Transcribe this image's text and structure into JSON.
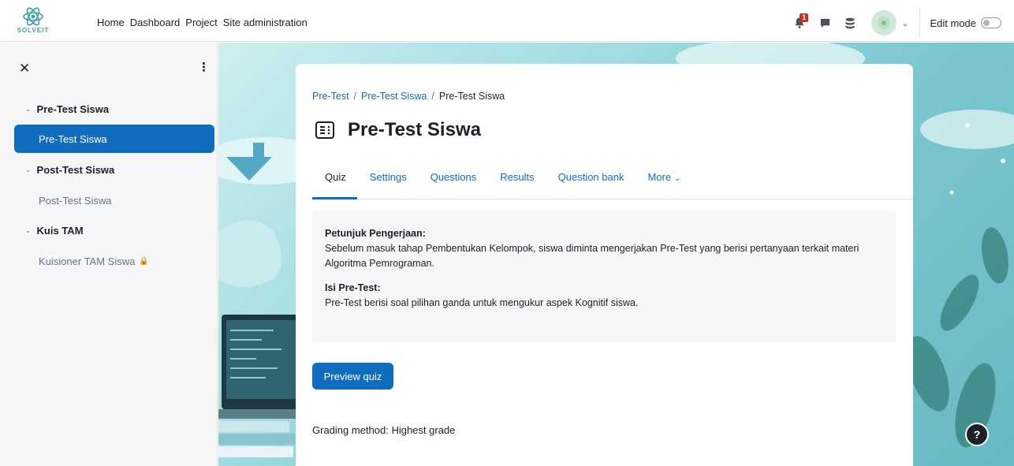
{
  "brand": {
    "logo_text": "SOLVEIT"
  },
  "nav": {
    "links": [
      "Home",
      "Dashboard",
      "Project",
      "Site administration"
    ],
    "notifications_count": "1",
    "edit_mode_label": "Edit mode"
  },
  "drawer": {
    "sections": [
      {
        "title": "Pre-Test Siswa",
        "items": [
          {
            "label": "Pre-Test Siswa",
            "active": true
          }
        ]
      },
      {
        "title": "Post-Test Siswa",
        "items": [
          {
            "label": "Post-Test Siswa",
            "active": false
          }
        ]
      },
      {
        "title": "Kuis TAM",
        "items": [
          {
            "label": "Kuisioner TAM Siswa",
            "active": false,
            "locked": true
          }
        ]
      }
    ]
  },
  "breadcrumb": [
    "Pre-Test",
    "Pre-Test Siswa",
    "Pre-Test Siswa"
  ],
  "page_title": "Pre-Test Siswa",
  "tabs": [
    "Quiz",
    "Settings",
    "Questions",
    "Results",
    "Question bank",
    "More"
  ],
  "intro": {
    "heading1": "Petunjuk Pengerjaan:",
    "text1": "Sebelum masuk tahap Pembentukan Kelompok, siswa diminta mengerjakan Pre-Test yang berisi pertanyaan terkait materi Algoritma Pemrograman.",
    "heading2": "Isi Pre-Test:",
    "text2": "Pre-Test berisi soal pilihan ganda untuk mengukur aspek Kognitif siswa."
  },
  "preview_button": "Preview quiz",
  "grading_method": "Grading method: Highest grade",
  "help_label": "?",
  "colors": {
    "primary": "#0f6cbf",
    "text": "#1d2125",
    "drawer_bg": "#f5f6f7",
    "badge": "#ca3120"
  },
  "icons": [
    "logo-icon",
    "bell-icon",
    "message-icon",
    "database-icon",
    "avatar",
    "chevron-down-icon",
    "close-icon",
    "kebab-icon",
    "quiz-icon",
    "lock-icon",
    "help-icon"
  ]
}
